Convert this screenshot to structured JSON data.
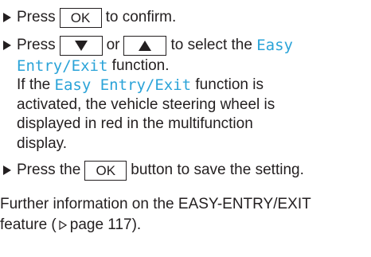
{
  "steps": {
    "s1": {
      "pre": "Press",
      "key": "OK",
      "post": "to confirm."
    },
    "s2": {
      "pre": "Press",
      "or": "or",
      "post": "to select the",
      "display_a": "Easy",
      "display_b": "Entry/Exit",
      "post2": "function.",
      "para_l1_pre": "If the",
      "para_l1_disp": "Easy Entry/Exit",
      "para_l1_post": "function is",
      "para_l2": "activated, the vehicle steering wheel is",
      "para_l3": "displayed in red in the multifunction",
      "para_l4": "display."
    },
    "s3": {
      "pre": "Press the",
      "key": "OK",
      "post": "button to save the setting."
    }
  },
  "footer": {
    "line1": "Further information on the EASY-ENTRY/EXIT",
    "line2_pre": "feature (",
    "line2_ref": "page 117).",
    "line2_space": " "
  },
  "colors": {
    "display_text": "#2aa3d8",
    "body_text": "#231f20"
  },
  "icons": {
    "bullet": "triangle-right-bullet-icon",
    "down": "arrow-down-key-icon",
    "up": "arrow-up-key-icon",
    "ref": "page-reference-triangle-icon"
  }
}
